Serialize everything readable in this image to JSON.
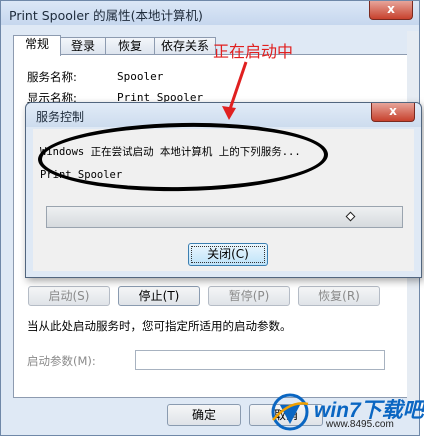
{
  "window": {
    "title": "Print Spooler 的属性(本地计算机)",
    "close_glyph": "x"
  },
  "tabs": [
    {
      "label": "常规"
    },
    {
      "label": "登录"
    },
    {
      "label": "恢复"
    },
    {
      "label": "依存关系"
    }
  ],
  "general": {
    "service_name_label": "服务名称:",
    "service_name_value": "Spooler",
    "display_name_label": "显示名称:",
    "display_name_value": "Print Spooler",
    "buttons": {
      "start": "启动(S)",
      "stop": "停止(T)",
      "pause": "暂停(P)",
      "resume": "恢复(R)"
    },
    "hint_text": "当从此处启动服务时，您可指定所适用的启动参数。",
    "params_label": "启动参数(M):",
    "params_value": ""
  },
  "footer": {
    "ok": "确定",
    "cancel": "取消"
  },
  "dialog": {
    "title": "服务控制",
    "close_glyph": "x",
    "message": "Windows 正在尝试启动 本地计算机 上的下列服务...",
    "service": "Print Spooler",
    "close_button": "关闭(C)"
  },
  "annotation": {
    "text": "正在启动中",
    "color": "#e02020"
  },
  "watermark": {
    "brand": "win7下载吧",
    "url": "www.8495.com"
  }
}
